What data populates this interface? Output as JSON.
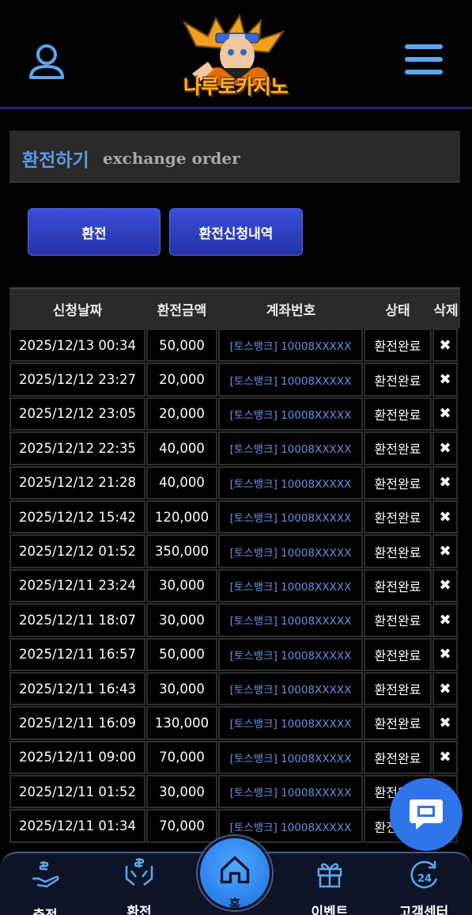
{
  "header": {
    "logo_text": "나루토카지노"
  },
  "title": {
    "korean": "환전하기",
    "english": "exchange order"
  },
  "tabs": {
    "exchange_label": "환전",
    "history_label": "환전신청내역"
  },
  "table": {
    "columns": [
      "신청날짜",
      "환전금액",
      "계좌번호",
      "상태",
      "삭제"
    ],
    "delete_glyph": "✖",
    "rows": [
      {
        "date": "2025/12/13 00:34",
        "amount": "50,000",
        "account": "[토스뱅크] 10008XXXXX",
        "status": "환전완료"
      },
      {
        "date": "2025/12/12 23:27",
        "amount": "20,000",
        "account": "[토스뱅크] 10008XXXXX",
        "status": "환전완료"
      },
      {
        "date": "2025/12/12 23:05",
        "amount": "20,000",
        "account": "[토스뱅크] 10008XXXXX",
        "status": "환전완료"
      },
      {
        "date": "2025/12/12 22:35",
        "amount": "40,000",
        "account": "[토스뱅크] 10008XXXXX",
        "status": "환전완료"
      },
      {
        "date": "2025/12/12 21:28",
        "amount": "40,000",
        "account": "[토스뱅크] 10008XXXXX",
        "status": "환전완료"
      },
      {
        "date": "2025/12/12 15:42",
        "amount": "120,000",
        "account": "[토스뱅크] 10008XXXXX",
        "status": "환전완료"
      },
      {
        "date": "2025/12/12 01:52",
        "amount": "350,000",
        "account": "[토스뱅크] 10008XXXXX",
        "status": "환전완료"
      },
      {
        "date": "2025/12/11 23:24",
        "amount": "30,000",
        "account": "[토스뱅크] 10008XXXXX",
        "status": "환전완료"
      },
      {
        "date": "2025/12/11 18:07",
        "amount": "30,000",
        "account": "[토스뱅크] 10008XXXXX",
        "status": "환전완료"
      },
      {
        "date": "2025/12/11 16:57",
        "amount": "50,000",
        "account": "[토스뱅크] 10008XXXXX",
        "status": "환전완료"
      },
      {
        "date": "2025/12/11 16:43",
        "amount": "30,000",
        "account": "[토스뱅크] 10008XXXXX",
        "status": "환전완료"
      },
      {
        "date": "2025/12/11 16:09",
        "amount": "130,000",
        "account": "[토스뱅크] 10008XXXXX",
        "status": "환전완료"
      },
      {
        "date": "2025/12/11 09:00",
        "amount": "70,000",
        "account": "[토스뱅크] 10008XXXXX",
        "status": "환전완료"
      },
      {
        "date": "2025/12/11 01:52",
        "amount": "30,000",
        "account": "[토스뱅크] 10008XXXXX",
        "status": "환전완료"
      },
      {
        "date": "2025/12/11 01:34",
        "amount": "70,000",
        "account": "[토스뱅크] 10008XXXXX",
        "status": "환전완료"
      }
    ]
  },
  "bottom_nav": {
    "deposit": "충전",
    "exchange": "환전",
    "home": "홈",
    "event": "이벤트",
    "support": "고객센터",
    "support_badge": "24"
  },
  "colors": {
    "accent_blue": "#2f74e8",
    "title_blue": "#5a9ae6",
    "account_blue": "#6a8ee0",
    "nav_icon_blue": "#5aa8f0"
  }
}
